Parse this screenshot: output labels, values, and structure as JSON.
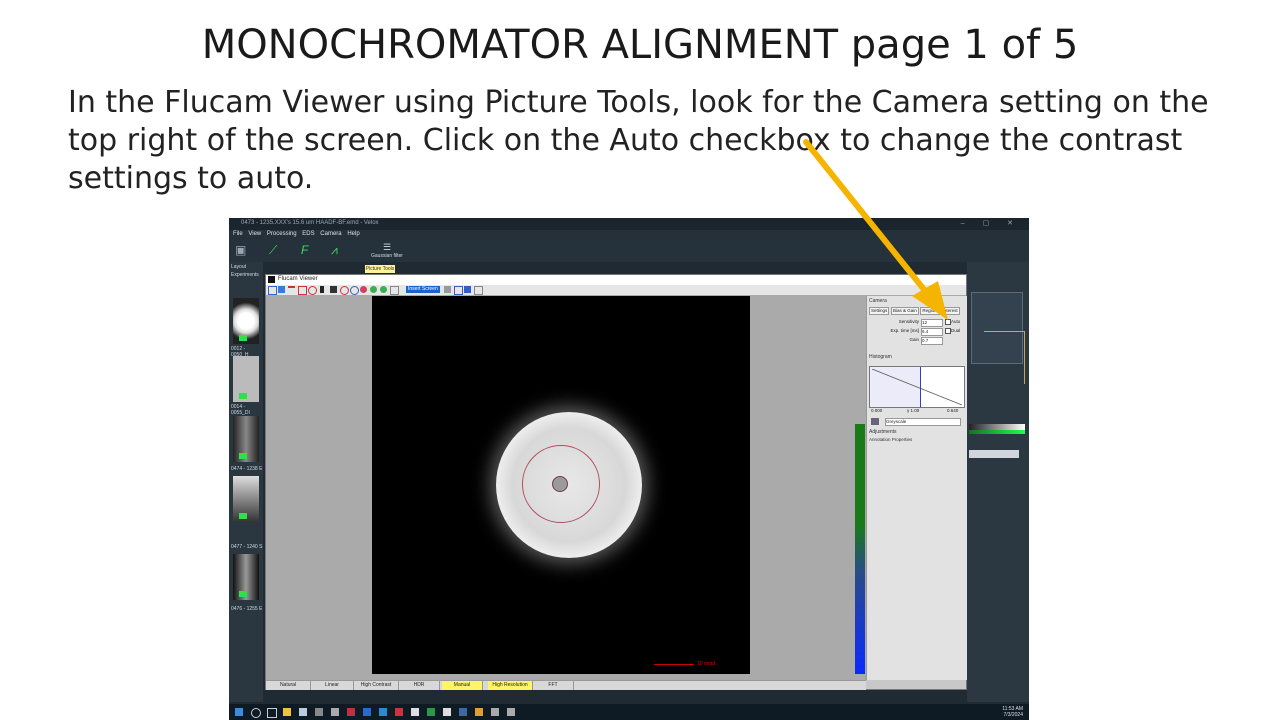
{
  "slide": {
    "title": "MONOCHROMATOR ALIGNMENT page 1 of 5",
    "body": "In the Flucam Viewer using Picture Tools, look for the Camera setting on the top right of the screen. Click on the Auto checkbox to change the contrast settings to auto."
  },
  "colors": {
    "arrow": "#f5b400",
    "accent_green": "#2ee04a",
    "highlight_yellow": "#fff36a"
  },
  "app": {
    "window_title": "0473 - 1235.XXX's 15.6 um HAADF-BF.emd - Velox",
    "menu": [
      "File",
      "View",
      "Processing",
      "EDS",
      "Camera",
      "Help"
    ],
    "ribbon_gaussian": "Gaussian filter",
    "layout_tab": "Layout",
    "experiments_label": "Experiments",
    "picture_tools_tab": "Picture Tools",
    "thumbnails": [
      "0012 - 0050_H",
      "0014 - 0055_DI",
      "0474 - 1238 E",
      "0477 - 1240 S",
      "0476 - 1255 E"
    ],
    "clock_time": "11:53 AM",
    "clock_date": "7/3/2024"
  },
  "flucam": {
    "window_title": "Flucam Viewer",
    "insert_screen": "Insert Screen",
    "scale_label": "10 mrad",
    "modes": [
      "Natural",
      "Linear",
      "High Contrast",
      "HDR",
      "Manual",
      "High Resolution",
      "FFT"
    ],
    "modes_highlighted": [
      "Manual",
      "High Resolution"
    ]
  },
  "camera_panel": {
    "header": "Camera",
    "tabs": [
      "Settings",
      "Bias & Gain",
      "Region of interest"
    ],
    "sensitivity_label": "Sensitivity",
    "sensitivity_value": "12",
    "exp_time_label": "Exp. time [ms]",
    "exp_time_value": "6.4",
    "gain_label": "Gain",
    "gain_value": "0.7",
    "auto_label": "Auto",
    "dual_label": "Dual",
    "auto_checked": false,
    "histogram_header": "Histogram",
    "histo_min": "0.000",
    "histo_gamma": "γ 1.00",
    "histo_max": "0.640",
    "colormap": "Greyscale",
    "adjustments": "Adjustments",
    "annotation_properties": "Annotation Properties"
  }
}
